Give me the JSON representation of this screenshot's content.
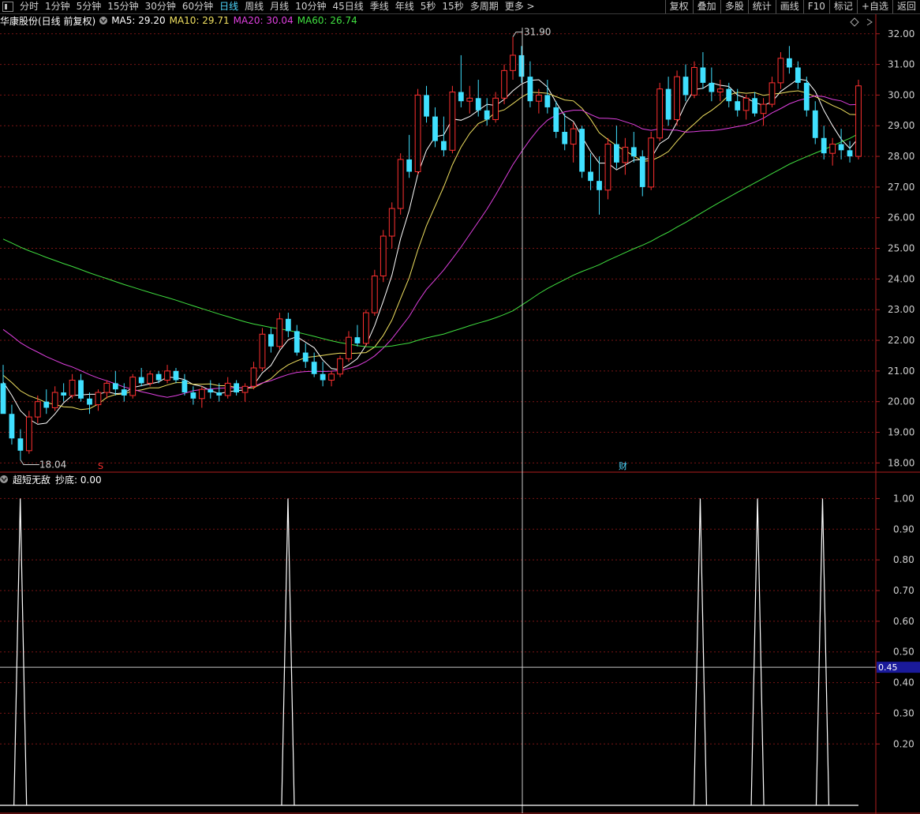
{
  "toolbar": {
    "periods": [
      "分时",
      "1分钟",
      "5分钟",
      "15分钟",
      "30分钟",
      "60分钟",
      "日线",
      "周线",
      "月线",
      "10分钟",
      "45日线",
      "季线",
      "年线",
      "5秒",
      "15秒",
      "多周期",
      "更多 >"
    ],
    "active_period": "日线",
    "tools": [
      "复权",
      "叠加",
      "多股",
      "统计",
      "画线",
      "F10",
      "标记",
      "+自选",
      "返回"
    ]
  },
  "stock": {
    "name": "华康股份(日线 前复权)",
    "ma": [
      {
        "label": "MA5: 29.20",
        "color": "#ffffff"
      },
      {
        "label": "MA10: 29.71",
        "color": "#f0e060"
      },
      {
        "label": "MA20: 30.04",
        "color": "#e040e0"
      },
      {
        "label": "MA60: 26.74",
        "color": "#40e040"
      }
    ]
  },
  "indicator": {
    "name": "超短无敌",
    "label": "抄底: 0.00",
    "cursor_value": "0.45"
  },
  "annotations": {
    "high": "31.90",
    "low": "18.04",
    "marker_s": "S",
    "marker_cai": "财"
  },
  "colors": {
    "up": "#ff3030",
    "down": "#40e0ff",
    "grid": "#7a1515",
    "axis": "#b01e1e"
  },
  "price_axis": {
    "min": 17.7,
    "max": 32.2,
    "ticks": [
      "32.00",
      "31.00",
      "30.00",
      "29.00",
      "28.00",
      "27.00",
      "26.00",
      "25.00",
      "24.00",
      "23.00",
      "22.00",
      "21.00",
      "20.00",
      "19.00",
      "18.00"
    ]
  },
  "ind_axis": {
    "min": 0,
    "max": 1.05,
    "ticks": [
      "1.00",
      "0.90",
      "0.80",
      "0.70",
      "0.60",
      "0.50",
      "0.40",
      "0.30",
      "0.20"
    ]
  },
  "chart_data": {
    "type": "candlestick",
    "candles": [
      [
        20.6,
        21.2,
        20.4,
        19.6
      ],
      [
        19.6,
        19.9,
        18.6,
        18.8
      ],
      [
        18.8,
        19.1,
        18.1,
        18.4
      ],
      [
        18.4,
        19.7,
        18.3,
        19.5
      ],
      [
        19.5,
        20.2,
        19.3,
        20.0
      ],
      [
        20.0,
        20.4,
        19.6,
        19.8
      ],
      [
        19.8,
        20.5,
        19.7,
        20.3
      ],
      [
        20.3,
        20.6,
        20.0,
        20.2
      ],
      [
        20.2,
        20.9,
        20.1,
        20.7
      ],
      [
        20.7,
        20.9,
        20.0,
        20.1
      ],
      [
        20.1,
        20.3,
        19.6,
        19.9
      ],
      [
        19.9,
        20.4,
        19.7,
        20.3
      ],
      [
        20.3,
        20.7,
        20.1,
        20.6
      ],
      [
        20.6,
        21.0,
        20.2,
        20.4
      ],
      [
        20.4,
        20.6,
        20.0,
        20.2
      ],
      [
        20.2,
        20.9,
        20.1,
        20.8
      ],
      [
        20.8,
        21.1,
        20.5,
        20.6
      ],
      [
        20.6,
        21.0,
        20.5,
        20.9
      ],
      [
        20.9,
        21.0,
        20.6,
        20.7
      ],
      [
        20.7,
        21.2,
        20.6,
        21.0
      ],
      [
        21.0,
        21.1,
        20.6,
        20.7
      ],
      [
        20.7,
        20.9,
        20.2,
        20.3
      ],
      [
        20.3,
        20.5,
        19.9,
        20.1
      ],
      [
        20.1,
        20.5,
        19.8,
        20.4
      ],
      [
        20.4,
        20.7,
        20.1,
        20.3
      ],
      [
        20.3,
        20.6,
        20.0,
        20.2
      ],
      [
        20.2,
        20.8,
        20.1,
        20.6
      ],
      [
        20.6,
        20.7,
        20.2,
        20.3
      ],
      [
        20.3,
        20.6,
        20.0,
        20.5
      ],
      [
        20.5,
        21.3,
        20.4,
        21.1
      ],
      [
        21.1,
        22.4,
        21.0,
        22.2
      ],
      [
        22.2,
        22.4,
        21.6,
        21.8
      ],
      [
        21.8,
        22.9,
        21.7,
        22.7
      ],
      [
        22.7,
        22.9,
        22.1,
        22.3
      ],
      [
        22.3,
        22.5,
        21.5,
        21.6
      ],
      [
        21.6,
        21.9,
        21.1,
        21.3
      ],
      [
        21.3,
        21.6,
        20.8,
        20.9
      ],
      [
        20.9,
        21.3,
        20.5,
        20.7
      ],
      [
        20.7,
        21.0,
        20.5,
        20.9
      ],
      [
        20.9,
        21.5,
        20.8,
        21.4
      ],
      [
        21.4,
        22.3,
        21.3,
        22.1
      ],
      [
        22.1,
        22.5,
        21.8,
        21.9
      ],
      [
        21.9,
        23.0,
        21.8,
        22.9
      ],
      [
        22.9,
        24.3,
        22.8,
        24.1
      ],
      [
        24.1,
        25.6,
        23.9,
        25.4
      ],
      [
        25.4,
        26.5,
        25.0,
        26.3
      ],
      [
        26.3,
        28.1,
        26.1,
        27.9
      ],
      [
        27.9,
        28.7,
        27.3,
        27.5
      ],
      [
        27.5,
        30.2,
        27.4,
        30.0
      ],
      [
        30.0,
        30.3,
        29.1,
        29.3
      ],
      [
        29.3,
        29.6,
        28.3,
        28.5
      ],
      [
        28.5,
        29.3,
        28.0,
        28.2
      ],
      [
        28.2,
        30.3,
        28.1,
        30.1
      ],
      [
        30.1,
        31.3,
        29.6,
        29.8
      ],
      [
        29.8,
        30.3,
        29.4,
        29.9
      ],
      [
        29.9,
        30.5,
        29.3,
        29.5
      ],
      [
        29.5,
        29.9,
        29.0,
        29.2
      ],
      [
        29.2,
        30.1,
        29.1,
        29.9
      ],
      [
        29.9,
        31.0,
        29.7,
        30.8
      ],
      [
        30.8,
        31.9,
        30.5,
        31.3
      ],
      [
        31.3,
        31.6,
        30.4,
        30.6
      ],
      [
        30.6,
        31.1,
        29.6,
        29.8
      ],
      [
        29.8,
        30.2,
        29.4,
        30.0
      ],
      [
        30.0,
        30.5,
        29.4,
        29.6
      ],
      [
        29.6,
        29.8,
        28.6,
        28.8
      ],
      [
        28.8,
        29.4,
        28.2,
        28.4
      ],
      [
        28.4,
        29.1,
        27.8,
        28.9
      ],
      [
        28.9,
        29.0,
        27.3,
        27.5
      ],
      [
        27.5,
        28.1,
        26.9,
        27.2
      ],
      [
        27.2,
        28.0,
        26.1,
        26.9
      ],
      [
        26.9,
        28.6,
        26.6,
        28.4
      ],
      [
        28.4,
        29.0,
        27.6,
        27.8
      ],
      [
        27.8,
        28.6,
        27.4,
        28.3
      ],
      [
        28.3,
        28.8,
        27.8,
        28.0
      ],
      [
        28.0,
        28.2,
        26.7,
        27.0
      ],
      [
        27.0,
        28.8,
        26.9,
        28.6
      ],
      [
        28.6,
        30.4,
        28.5,
        30.2
      ],
      [
        30.2,
        30.6,
        29.0,
        29.2
      ],
      [
        29.2,
        30.8,
        29.0,
        30.6
      ],
      [
        30.6,
        31.0,
        29.8,
        30.0
      ],
      [
        30.0,
        31.1,
        29.9,
        30.9
      ],
      [
        30.9,
        31.4,
        30.2,
        30.4
      ],
      [
        30.4,
        30.9,
        29.8,
        30.1
      ],
      [
        30.1,
        30.5,
        29.8,
        30.2
      ],
      [
        30.2,
        30.4,
        29.6,
        29.8
      ],
      [
        29.8,
        30.2,
        29.3,
        29.5
      ],
      [
        29.5,
        30.0,
        29.2,
        29.9
      ],
      [
        29.9,
        30.1,
        29.3,
        29.4
      ],
      [
        29.4,
        29.9,
        29.0,
        29.7
      ],
      [
        29.7,
        30.6,
        29.6,
        30.4
      ],
      [
        30.4,
        31.4,
        30.2,
        31.2
      ],
      [
        31.2,
        31.6,
        30.7,
        30.9
      ],
      [
        30.9,
        31.1,
        30.2,
        30.4
      ],
      [
        30.4,
        30.6,
        29.3,
        29.5
      ],
      [
        29.5,
        29.8,
        28.4,
        28.6
      ],
      [
        28.6,
        29.0,
        27.9,
        28.1
      ],
      [
        28.1,
        28.6,
        27.7,
        28.4
      ],
      [
        28.4,
        28.9,
        27.9,
        28.2
      ],
      [
        28.2,
        28.5,
        27.8,
        28.0
      ],
      [
        28.0,
        30.5,
        27.9,
        30.3
      ]
    ],
    "signals": [
      0.02,
      0.333,
      0.815,
      0.882,
      0.958
    ]
  }
}
